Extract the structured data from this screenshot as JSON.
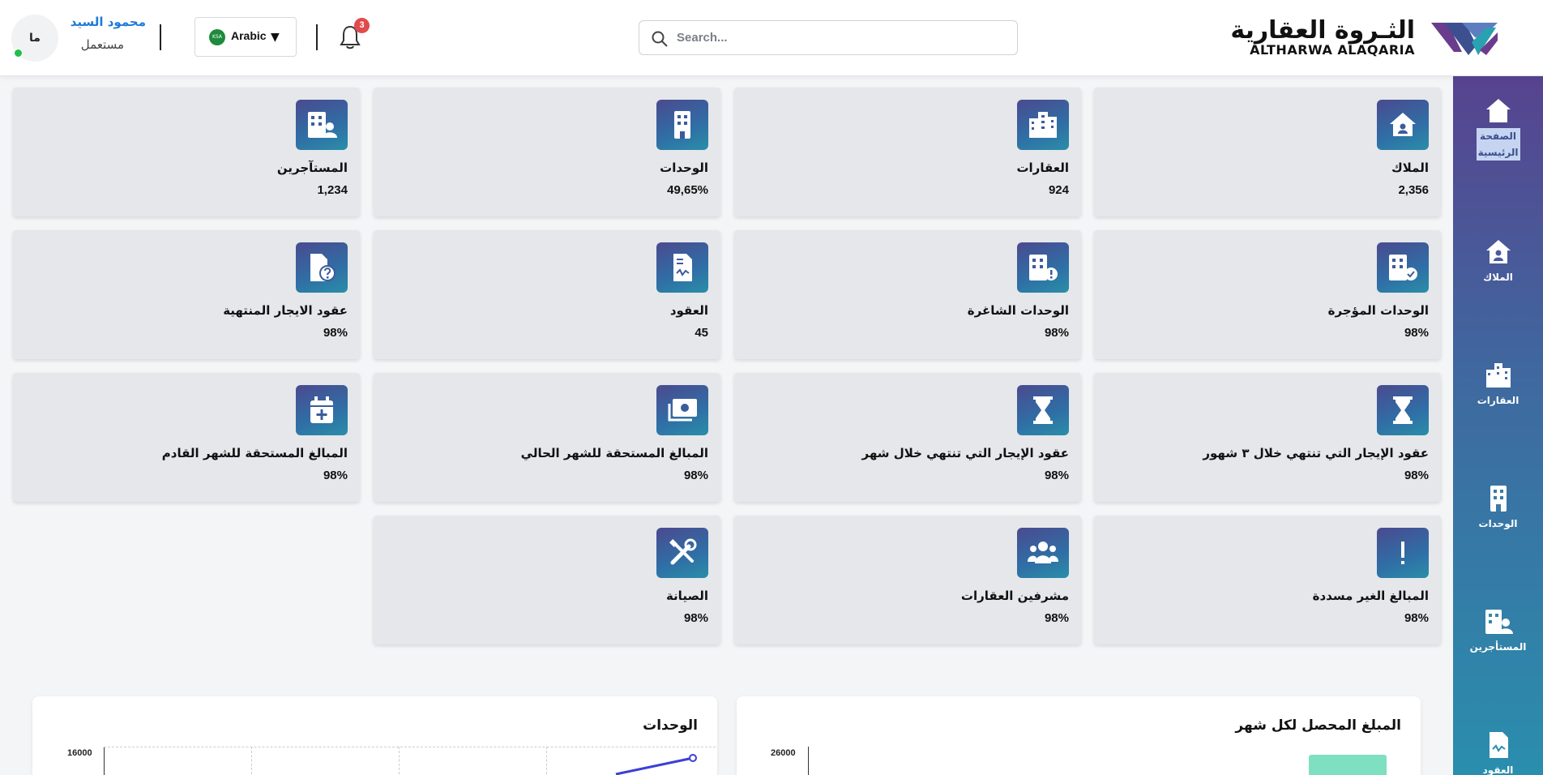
{
  "header": {
    "logo_ar": "الثـروة العقارية",
    "logo_en": "ALTHARWA ALAQARIA",
    "search_placeholder": "Search...",
    "notification_count": "3",
    "language": "Arabic",
    "flag_text": "KSA",
    "user_name": "محمود السيد",
    "user_role": "مستعمل",
    "avatar_initials": "ما"
  },
  "sidebar": {
    "items": [
      {
        "label": "الصفحة الرئيسية",
        "icon": "home-icon",
        "active": true
      },
      {
        "label": "الملاك",
        "icon": "owners-icon"
      },
      {
        "label": "العقارات",
        "icon": "properties-icon"
      },
      {
        "label": "الوحدات",
        "icon": "units-icon"
      },
      {
        "label": "المستأجرين",
        "icon": "tenants-icon"
      },
      {
        "label": "العقود",
        "icon": "contracts-icon"
      }
    ]
  },
  "cards": [
    {
      "title": "الملاك",
      "value": "2,356",
      "icon": "owner-house-icon"
    },
    {
      "title": "العقارات",
      "value": "924",
      "icon": "city-buildings-icon"
    },
    {
      "title": "الوحدات",
      "value": "49,65%",
      "icon": "building-icon"
    },
    {
      "title": "المستآجرين",
      "value": "1,234",
      "icon": "building-user-icon"
    },
    {
      "title": "الوحدات المؤجرة",
      "value": "98%",
      "icon": "building-check-icon"
    },
    {
      "title": "الوحدات الشاغرة",
      "value": "98%",
      "icon": "building-alert-icon"
    },
    {
      "title": "العقود",
      "value": "45",
      "icon": "contract-icon"
    },
    {
      "title": "عقود الايجار المنتهية",
      "value": "98%",
      "icon": "file-question-icon"
    },
    {
      "title": "عقود الإيجار التي تنتهي خلال ٣ شهور",
      "value": "98%",
      "icon": "hourglass-icon"
    },
    {
      "title": "عقود الإيجار التي تنتهي خلال شهر",
      "value": "98%",
      "icon": "hourglass-icon"
    },
    {
      "title": "المبالغ المستحقة للشهر الحالي",
      "value": "98%",
      "icon": "money-icon"
    },
    {
      "title": "المبالغ المستحقة للشهر القادم",
      "value": "98%",
      "icon": "calendar-plus-icon"
    },
    {
      "title": "المبالغ الغير مسددة",
      "value": "98%",
      "icon": "exclamation-icon"
    },
    {
      "title": "مشرفين العقارات",
      "value": "98%",
      "icon": "users-group-icon"
    },
    {
      "title": "الصيانة",
      "value": "98%",
      "icon": "tools-icon"
    }
  ],
  "charts": {
    "collected": {
      "title": "المبلغ المحصل لكل شهر",
      "y_top_tick": "26000",
      "bar_color": "#7ee0c0"
    },
    "units": {
      "title": "الوحدات",
      "y_top_tick": "16000",
      "line_color": "#3b3fd6"
    }
  },
  "chart_data": [
    {
      "type": "bar",
      "title": "المبلغ المحصل لكل شهر",
      "y_ticks": [
        26000
      ],
      "series": [
        {
          "values": [
            26000
          ]
        }
      ]
    },
    {
      "type": "line",
      "title": "الوحدات",
      "y_ticks": [
        16000
      ],
      "series": [
        {
          "values": [
            16000
          ]
        }
      ]
    }
  ],
  "colors": {
    "accent": "#1f7ad9",
    "sidebar_top": "#57438f",
    "sidebar_bottom": "#2a8eae",
    "badge": "#e04b4b"
  }
}
